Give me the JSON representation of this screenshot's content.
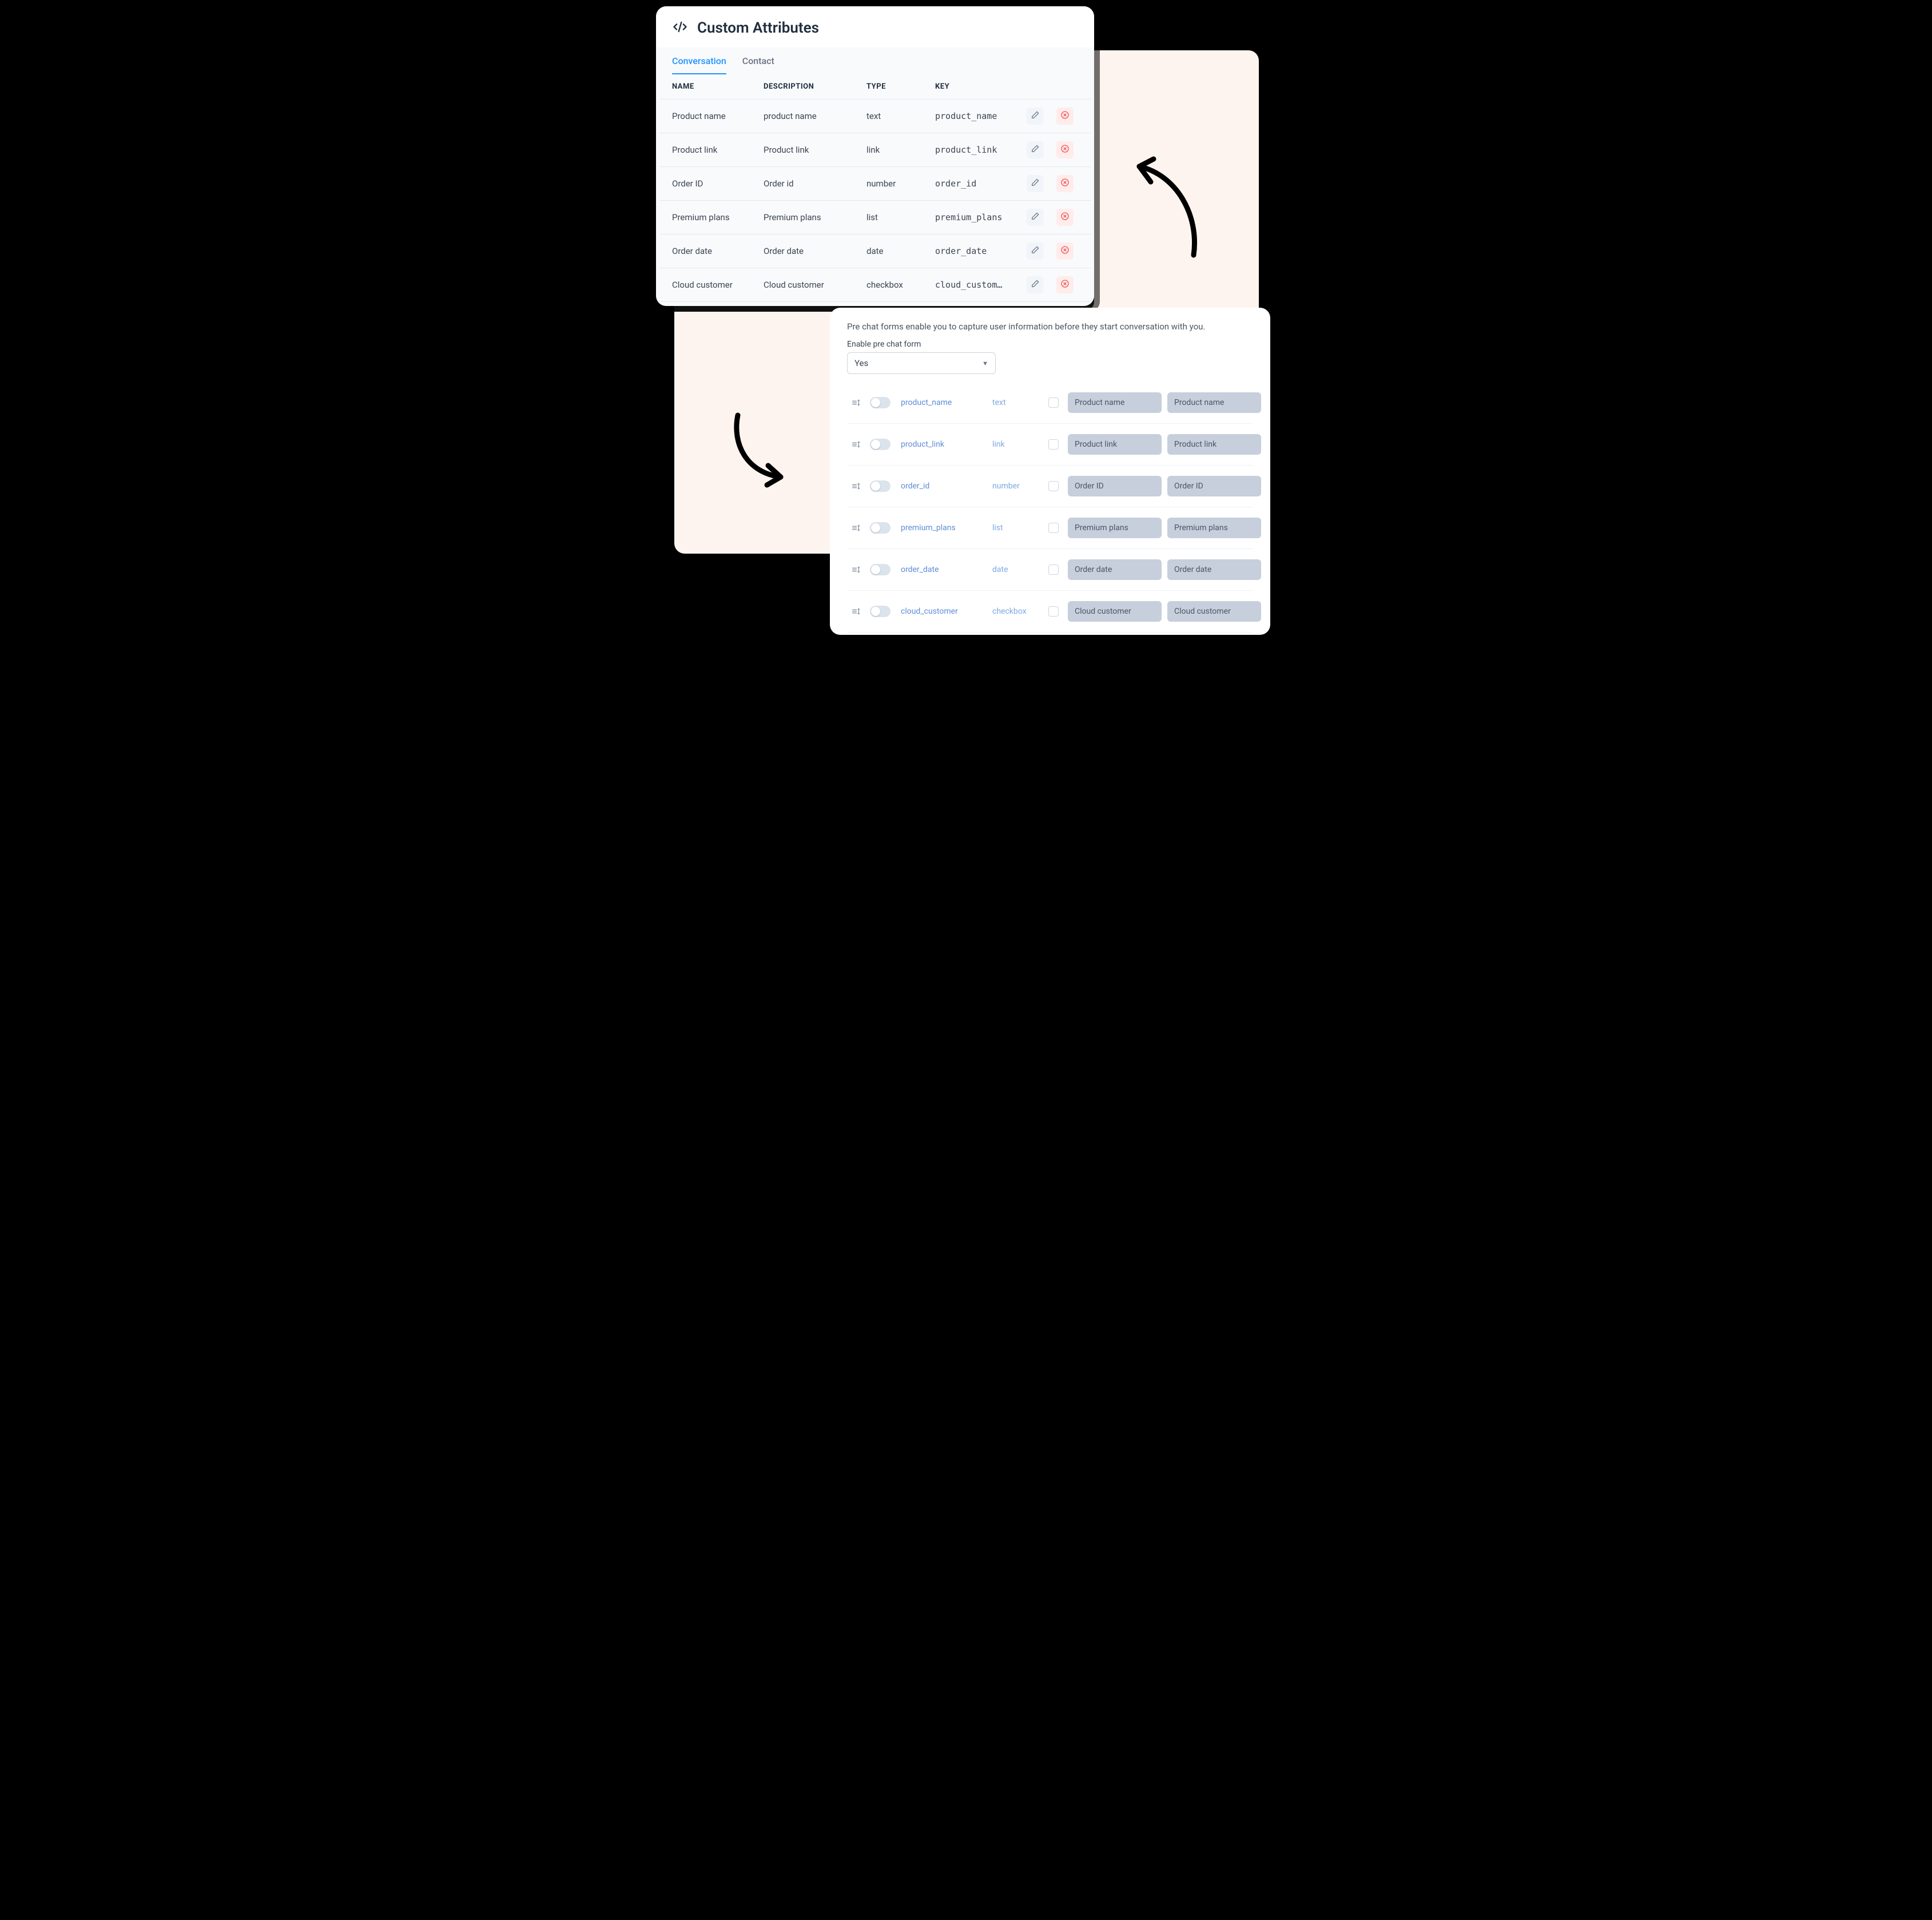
{
  "panel1": {
    "title": "Custom Attributes",
    "tabs": [
      "Conversation",
      "Contact"
    ],
    "active_tab": 0,
    "columns": [
      "NAME",
      "DESCRIPTION",
      "TYPE",
      "KEY"
    ],
    "rows": [
      {
        "name": "Product name",
        "desc": "product name",
        "type": "text",
        "key": "product_name"
      },
      {
        "name": "Product link",
        "desc": "Product link",
        "type": "link",
        "key": "product_link"
      },
      {
        "name": "Order ID",
        "desc": "Order id",
        "type": "number",
        "key": "order_id"
      },
      {
        "name": "Premium plans",
        "desc": "Premium plans",
        "type": "list",
        "key": "premium_plans"
      },
      {
        "name": "Order date",
        "desc": "Order date",
        "type": "date",
        "key": "order_date"
      },
      {
        "name": "Cloud customer",
        "desc": "Cloud customer",
        "type": "checkbox",
        "key": "cloud_custom…"
      }
    ]
  },
  "panel2": {
    "description": "Pre chat forms enable you to capture user information before they start conversation with you.",
    "enable_label": "Enable pre chat form",
    "enable_value": "Yes",
    "rows": [
      {
        "key": "product_name",
        "type": "text",
        "label": "Product name",
        "placeholder": "Product name"
      },
      {
        "key": "product_link",
        "type": "link",
        "label": "Product link",
        "placeholder": "Product link"
      },
      {
        "key": "order_id",
        "type": "number",
        "label": "Order ID",
        "placeholder": "Order ID"
      },
      {
        "key": "premium_plans",
        "type": "list",
        "label": "Premium plans",
        "placeholder": "Premium plans"
      },
      {
        "key": "order_date",
        "type": "date",
        "label": "Order date",
        "placeholder": "Order date"
      },
      {
        "key": "cloud_customer",
        "type": "checkbox",
        "label": "Cloud customer",
        "placeholder": "Cloud customer"
      }
    ]
  }
}
